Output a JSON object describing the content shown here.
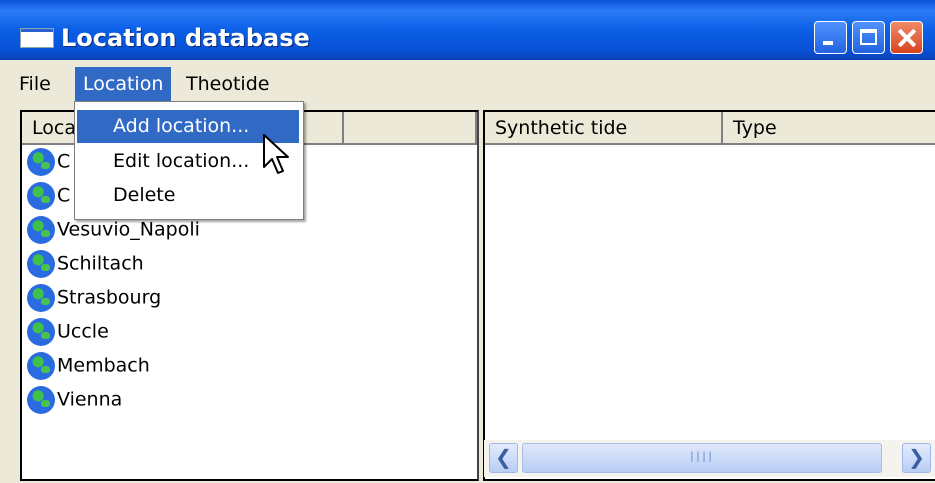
{
  "window": {
    "title": "Location database"
  },
  "title_buttons": [
    "minimize",
    "maximize",
    "close"
  ],
  "menubar": {
    "items": [
      "File",
      "Location",
      "Theotide"
    ],
    "active": "Location"
  },
  "left_panel": {
    "header": "Location",
    "visible_header": "Loca",
    "items": [
      "C",
      "C",
      "Vesuvio_Napoli",
      "Schiltach",
      "Strasbourg",
      "Uccle",
      "Membach",
      "Vienna"
    ],
    "item_icon": "globe-icon"
  },
  "right_panel": {
    "columns": [
      "Synthetic tide",
      "Type"
    ],
    "scrollbar_grip": "IIII"
  },
  "location_menu": {
    "items": [
      "Add location...",
      "Edit location...",
      "Delete"
    ],
    "highlighted": "Add location..."
  },
  "colors": {
    "titlebar": "#0b5fe6",
    "highlight": "#316ac5",
    "window_bg": "#ece9d8"
  }
}
